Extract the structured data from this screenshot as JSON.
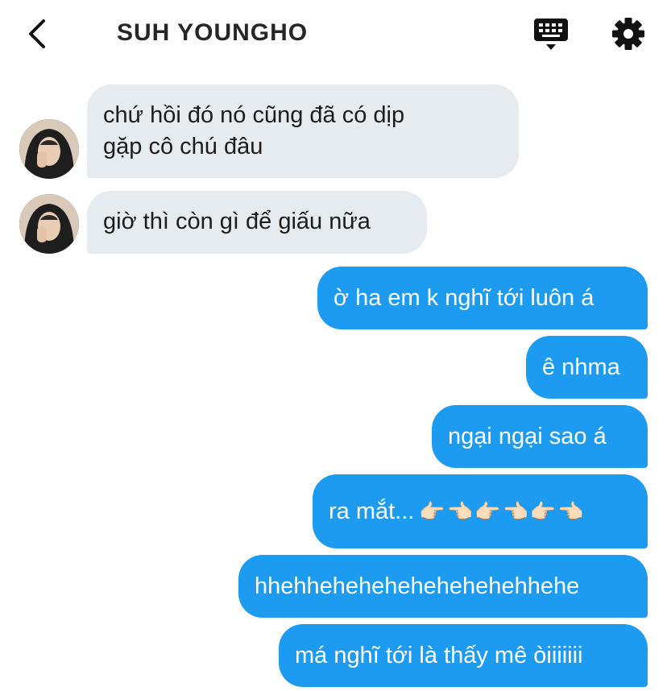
{
  "header": {
    "title": "SUH YOUNGHO"
  },
  "icons": {
    "back": "chevron-left-icon",
    "keyboard": "keyboard-icon",
    "settings": "gear-icon"
  },
  "messages": {
    "incoming": [
      {
        "line1": "chứ hồi đó nó cũng đã có dịp",
        "line2": "gặp cô chú đâu"
      },
      {
        "text": "giờ thì còn gì để giấu nữa"
      }
    ],
    "outgoing": [
      {
        "text": "ờ ha em k nghĩ tới luôn á"
      },
      {
        "text": "ê nhma"
      },
      {
        "text": "ngại ngại sao á"
      },
      {
        "text": "ra mắt...",
        "emoji": "👉🏻👈🏻👉🏻👈🏻👉🏻👈🏻"
      },
      {
        "text": "hhehhehehehehehehehehhehe"
      },
      {
        "text": "má nghĩ tới là thấy mê òiiiiiii"
      }
    ]
  },
  "colors": {
    "incoming_bubble": "#e6ebf0",
    "outgoing_bubble": "#1d9bf0"
  }
}
